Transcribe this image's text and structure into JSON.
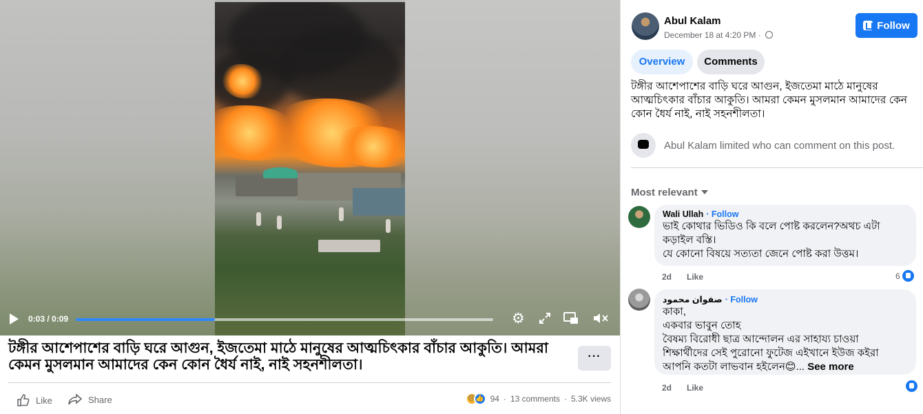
{
  "video": {
    "timecode": "0:03 / 0:09",
    "progress": 0.3333,
    "caption": "টঙ্গীর আশেপাশের বাড়ি ঘরে আগুন, ইজতেমা মাঠে মানুষের আত্মচিৎকার বাঁচার আকুতি। আমরা কেমন মুসলমান আমাদের কেন কোন ধৈর্য নাই, নাই সহনশীলতা।",
    "more_label": "···",
    "icons": [
      "play-icon",
      "settings-icon",
      "expand-icon",
      "picture-in-picture-icon",
      "mute-icon"
    ]
  },
  "actions": {
    "like_label": "Like",
    "share_label": "Share",
    "reaction_count": "94",
    "dot": "·",
    "comments_count": "13 comments",
    "views_count": "5.3K views"
  },
  "author": {
    "name": "Abul Kalam",
    "timestamp": "December 18 at 4:20 PM · ",
    "follow_label": "Follow"
  },
  "tabs": {
    "overview": "Overview",
    "comments": "Comments"
  },
  "post": {
    "text": "টঙ্গীর আশেপাশের বাড়ি ঘরে আগুন, ইজতেমা মাঠে মানুষের\nআত্মচিৎকার বাঁচার আকুতি। আমরা কেমন মুসলমান আমাদের কেন\nকোন ধৈর্য নাই, নাই সহনশীলতা।",
    "restriction": "Abul Kalam limited who can comment on this post."
  },
  "comments_section": {
    "sort_label": "Most relevant",
    "comments": [
      {
        "author": "Wali Ullah",
        "follow": "Follow",
        "text": "ভাই কোথার ভিডিও কি বলে পোষ্ট করলেন?অথচ এটা\nকড়াইল বস্তি।\nযে কোনো বিষয়ে সত্যতা জেনে পোষ্ট করা উত্তম।",
        "age": "2d",
        "like": "Like",
        "reactions": "6"
      },
      {
        "author": "صفوان محمود",
        "follow": "Follow",
        "text": "কাকা,\nএকবার ভাবুন তোহ\nবৈষম্য বিরোধী ছাত্র আন্দোলন এর সাহায্য চাওয়া\nশিক্ষার্থীদের সেই পুরোনো ফুটেজ এইখানে ইউজ কইরা\nআপনি কতটা লাভবান হইলেন😊... ",
        "see_more": "See more",
        "age": "2d",
        "like": "Like",
        "reactions": ""
      }
    ]
  },
  "colors": {
    "accent": "#1877f2",
    "secondary_text": "#65676b",
    "bubble": "#f0f2f5"
  }
}
